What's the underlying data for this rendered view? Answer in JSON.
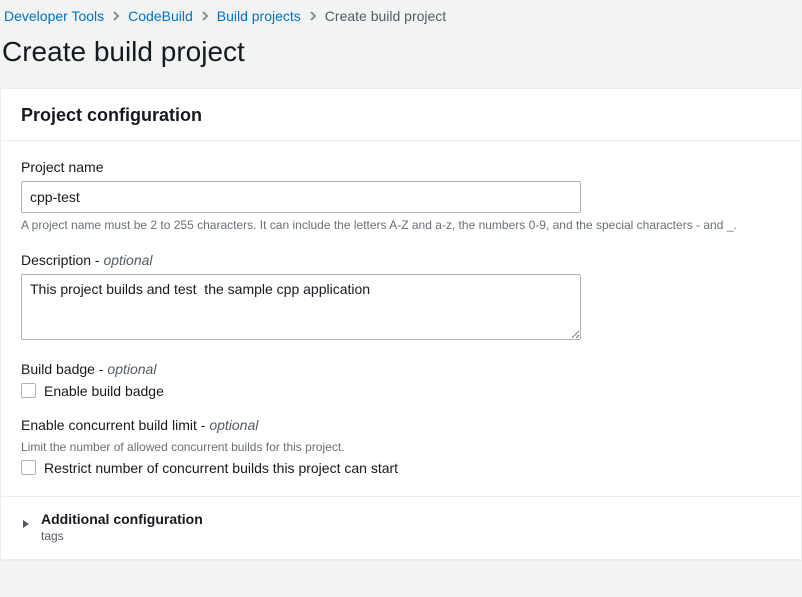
{
  "breadcrumb": {
    "items": [
      {
        "label": "Developer Tools",
        "link": true
      },
      {
        "label": "CodeBuild",
        "link": true
      },
      {
        "label": "Build projects",
        "link": true
      },
      {
        "label": "Create build project",
        "link": false
      }
    ]
  },
  "page": {
    "title": "Create build project"
  },
  "panel": {
    "title": "Project configuration",
    "project_name": {
      "label": "Project name",
      "value": "cpp-test",
      "help": "A project name must be 2 to 255 characters. It can include the letters A-Z and a-z, the numbers 0-9, and the special characters - and _."
    },
    "description": {
      "label": "Description - ",
      "optional": "optional",
      "value": "This project builds and test  the sample cpp application"
    },
    "build_badge": {
      "label": "Build badge - ",
      "optional": "optional",
      "checkbox_label": "Enable build badge",
      "checked": false
    },
    "concurrent": {
      "label": "Enable concurrent build limit - ",
      "optional": "optional",
      "help": "Limit the number of allowed concurrent builds for this project.",
      "checkbox_label": "Restrict number of concurrent builds this project can start",
      "checked": false
    },
    "additional": {
      "title": "Additional configuration",
      "subtitle": "tags"
    }
  }
}
